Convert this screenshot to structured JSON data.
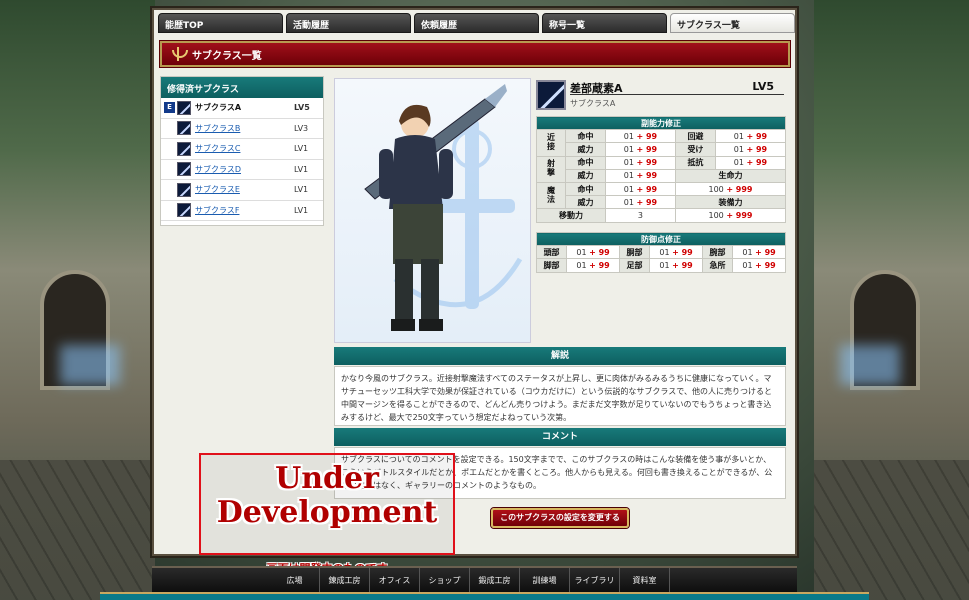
{
  "tabs": [
    {
      "label": "能歴TOP",
      "active": false
    },
    {
      "label": "活動履歴",
      "active": false
    },
    {
      "label": "依頼履歴",
      "active": false
    },
    {
      "label": "称号一覧",
      "active": false
    },
    {
      "label": "サブクラス一覧",
      "active": true
    }
  ],
  "page_title": "サブクラス一覧",
  "list": {
    "header": "修得済サブクラス",
    "items": [
      {
        "badge": "E",
        "name": "サブクラスA",
        "lv": "LV5",
        "selected": true
      },
      {
        "badge": "",
        "name": "サブクラスB",
        "lv": "LV3",
        "selected": false
      },
      {
        "badge": "",
        "name": "サブクラスC",
        "lv": "LV1",
        "selected": false
      },
      {
        "badge": "",
        "name": "サブクラスD",
        "lv": "LV1",
        "selected": false
      },
      {
        "badge": "",
        "name": "サブクラスE",
        "lv": "LV1",
        "selected": false
      },
      {
        "badge": "",
        "name": "サブクラスF",
        "lv": "LV1",
        "selected": false
      }
    ]
  },
  "detail": {
    "name": "差部蔵素A",
    "lv": "LV5",
    "sub": "サブクラスA"
  },
  "ability": {
    "header": "副能力修正",
    "groups": {
      "melee": "近接",
      "ranged": "射撃",
      "magic": "魔法"
    },
    "labels": {
      "hit": "命中",
      "power": "威力",
      "evade": "回避",
      "receive": "受け",
      "resist": "抵抗",
      "life": "生命力",
      "move": "移動力",
      "equip": "装備力"
    },
    "base": "01",
    "plus": "+ 99",
    "life_base": "100",
    "life_plus": "+ 999",
    "move_val": "3",
    "equip_base": "100",
    "equip_plus": "+ 999"
  },
  "defense": {
    "header": "防御点修正",
    "labels": {
      "head": "頭部",
      "torso": "胴部",
      "arm": "腕部",
      "leg": "脚部",
      "foot": "足部",
      "vital": "急所"
    },
    "base": "01",
    "plus": "+ 99"
  },
  "description": {
    "header": "解説",
    "text": "かなり今風のサブクラス。近接射撃魔法すべてのステータスが上昇し、更に肉体がみるみるうちに健康になっていく。マサチューセッツ工科大学で効果が保証されている（コウカだけに）という伝説的なサブクラスで、他の人に売りつけると中間マージンを得ることができるので、どんどん売りつけよう。まだまだ文字数が足りていないのでもうちょっと書き込みするけど、最大で250文字っていう想定だよねっていう次第。"
  },
  "comment": {
    "header": "コメント",
    "text": "サブクラスについてのコメントを設定できる。150文字までで、このサブクラスの時はこんな装備を使う事が多いとか、こういうバトルスタイルだとか、ポエムだとかを書くところ。他人からも見える。何回も書き換えることができるが、公認設定ではなく、ギャラリーのコメントのようなもの。"
  },
  "change_button": "このサブクラスの設定を変更する",
  "dev_notice": {
    "line1": "Under",
    "line2": "Development",
    "sub": "画面は開発中のものです"
  },
  "bottom_nav": [
    {
      "label": "広場"
    },
    {
      "label": "錬成工房"
    },
    {
      "label": "オフィス"
    },
    {
      "label": "ショップ"
    },
    {
      "label": "鍛成工房"
    },
    {
      "label": "訓練場"
    },
    {
      "label": "ライブラリ"
    },
    {
      "label": "資料室"
    }
  ]
}
